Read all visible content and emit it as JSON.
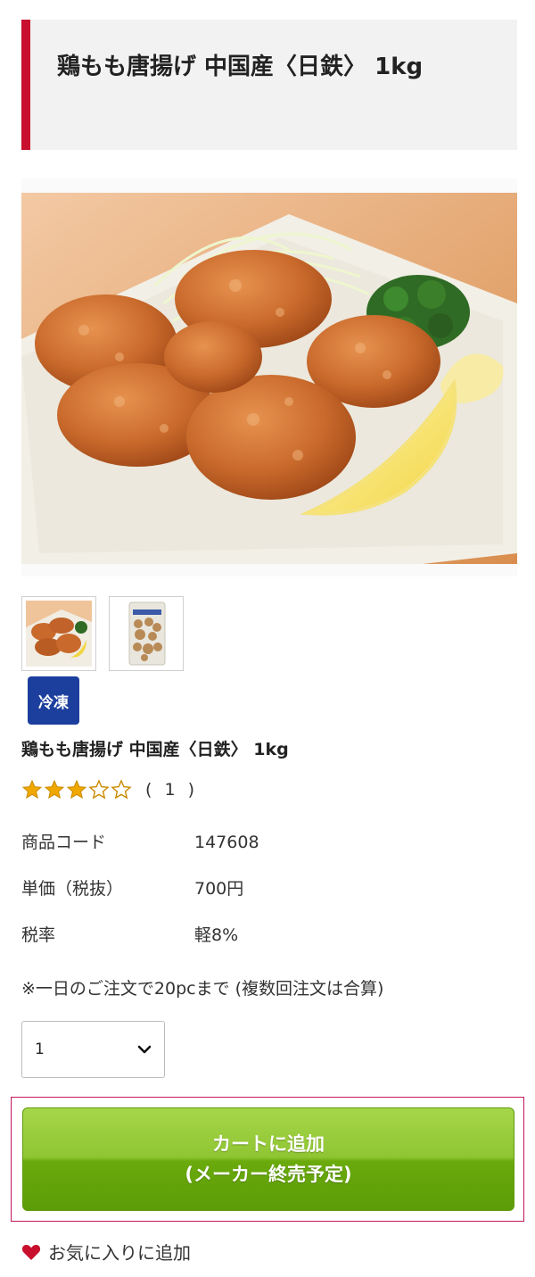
{
  "product": {
    "title": "鶏もも唐揚げ 中国産〈日鉄〉 1kg",
    "name": "鶏もも唐揚げ 中国産〈日鉄〉 1kg",
    "storage_badge": "冷凍",
    "rating": {
      "stars": 3,
      "max": 5,
      "review_count_text": "( 1 )"
    }
  },
  "gallery": {
    "main_image_icon": "fried-chicken-photo",
    "thumbnails": [
      {
        "icon": "fried-chicken-thumbnail"
      },
      {
        "icon": "package-thumbnail"
      }
    ]
  },
  "specs": [
    {
      "label": "商品コード",
      "value": "147608"
    },
    {
      "label": "単価（税抜）",
      "value": "700円"
    },
    {
      "label": "税率",
      "value": "軽8%"
    }
  ],
  "order_note": "※一日のご注文で20pcまで (複数回注文は合算)",
  "quantity": {
    "selected": "1"
  },
  "cart_button": {
    "line1": "カートに追加",
    "line2": "(メーカー終売予定)"
  },
  "favorite": {
    "label": "お気に入りに追加",
    "icon": "heart-icon"
  },
  "colors": {
    "accent_red": "#c8102e",
    "frozen_badge": "#1c3f9e",
    "button_green": "#7cb518",
    "star": "#f0a800"
  }
}
